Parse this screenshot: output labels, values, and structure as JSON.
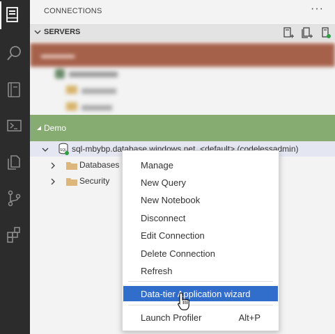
{
  "sidebar": {
    "title": "CONNECTIONS",
    "more": "···",
    "servers": {
      "label": "SERVERS"
    }
  },
  "tree": {
    "group": "Demo",
    "server": "sql-mbybp.database.windows.net, <default> (codelessadmin)",
    "children": [
      "Databases",
      "Security"
    ]
  },
  "menu": {
    "items": [
      "Manage",
      "New Query",
      "New Notebook",
      "Disconnect",
      "Edit Connection",
      "Delete Connection",
      "Refresh",
      "Data-tier Application wizard",
      "Launch Profiler"
    ],
    "launch_profiler_shortcut": "Alt+P",
    "highlighted": "Data-tier Application wizard"
  },
  "colors": {
    "activity_bar": "#2c2c2c",
    "demo_group": "#86ac71",
    "hidden_group": "#a6614b",
    "menu_highlight": "#316dca",
    "status_dot": "#2ea043"
  }
}
